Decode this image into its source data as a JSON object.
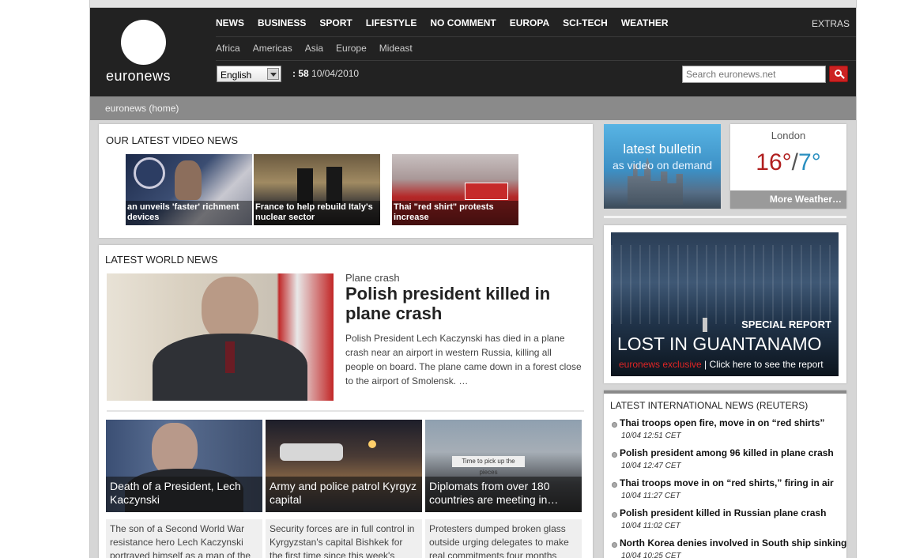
{
  "brand": {
    "logo_text": "euronews"
  },
  "nav": {
    "main": [
      "NEWS",
      "BUSINESS",
      "SPORT",
      "LIFESTYLE",
      "NO COMMENT",
      "EUROPA",
      "SCI-TECH",
      "WEATHER"
    ],
    "extras": "EXTRAS",
    "sub": [
      "Africa",
      "Americas",
      "Asia",
      "Europe",
      "Mideast"
    ]
  },
  "toolbar": {
    "language": "English",
    "time": ": 58",
    "date": "10/04/2010",
    "search_placeholder": "Search euronews.net"
  },
  "breadcrumb": "euronews (home)",
  "video_news": {
    "title": "OUR LATEST VIDEO NEWS",
    "items": [
      {
        "caption": "an unveils 'faster' richment devices"
      },
      {
        "caption": "France to help rebuild Italy's nuclear sector"
      },
      {
        "caption": "Thai \"red shirt\" protests increase"
      }
    ]
  },
  "bulletin": {
    "line1": "latest bulletin",
    "line2": "as video on demand"
  },
  "weather": {
    "city": "London",
    "high": "16°",
    "sep": "/",
    "low": "7°",
    "more": "More Weather…",
    "high_color": "#b01e1e",
    "low_color": "#2a8fc0"
  },
  "world_news": {
    "title": "LATEST WORLD NEWS",
    "lead": {
      "kicker": "Plane crash",
      "headline": "Polish president killed in plane crash",
      "body": "Polish President Lech Kaczynski has died in a plane crash near an airport in western Russia, killing all people on board.  The plane came down in a forest close to the airport of Smolensk.  …"
    },
    "stories": [
      {
        "caption": "Death of a President, Lech Kaczynski",
        "text": "The son of a Second World War resistance hero Lech Kaczynski portrayed himself as a man of the"
      },
      {
        "caption": "Army and police patrol Kyrgyz capital",
        "text": "Security forces are in full control in Kyrgyzstan's capital Bishkek for the first time since this week's"
      },
      {
        "caption": "Diplomats from over 180 countries are meeting in…",
        "text": "Protesters dumped broken glass outside urging delegates to make real commitments four months"
      }
    ],
    "banner_text": "Time to pick up the pieces"
  },
  "special_report": {
    "kicker": "SPECIAL REPORT",
    "title": "LOST IN GUANTANAMO",
    "exclusive": "euronews exclusive",
    "link": " | Click here to see the report"
  },
  "reuters": {
    "title": "LATEST INTERNATIONAL NEWS (REUTERS)",
    "items": [
      {
        "title": "Thai troops open fire, move in on “red shirts”",
        "time": "10/04 12:51 CET"
      },
      {
        "title": "Polish president among 96 killed in plane crash",
        "time": "10/04 12:47 CET"
      },
      {
        "title": "Thai troops move in on “red shirts,” firing in air",
        "time": "10/04 11:27 CET"
      },
      {
        "title": "Polish president killed in Russian plane crash",
        "time": "10/04 11:02 CET"
      },
      {
        "title": "North Korea denies involved in South ship sinking",
        "time": "10/04 10:25 CET"
      }
    ]
  }
}
